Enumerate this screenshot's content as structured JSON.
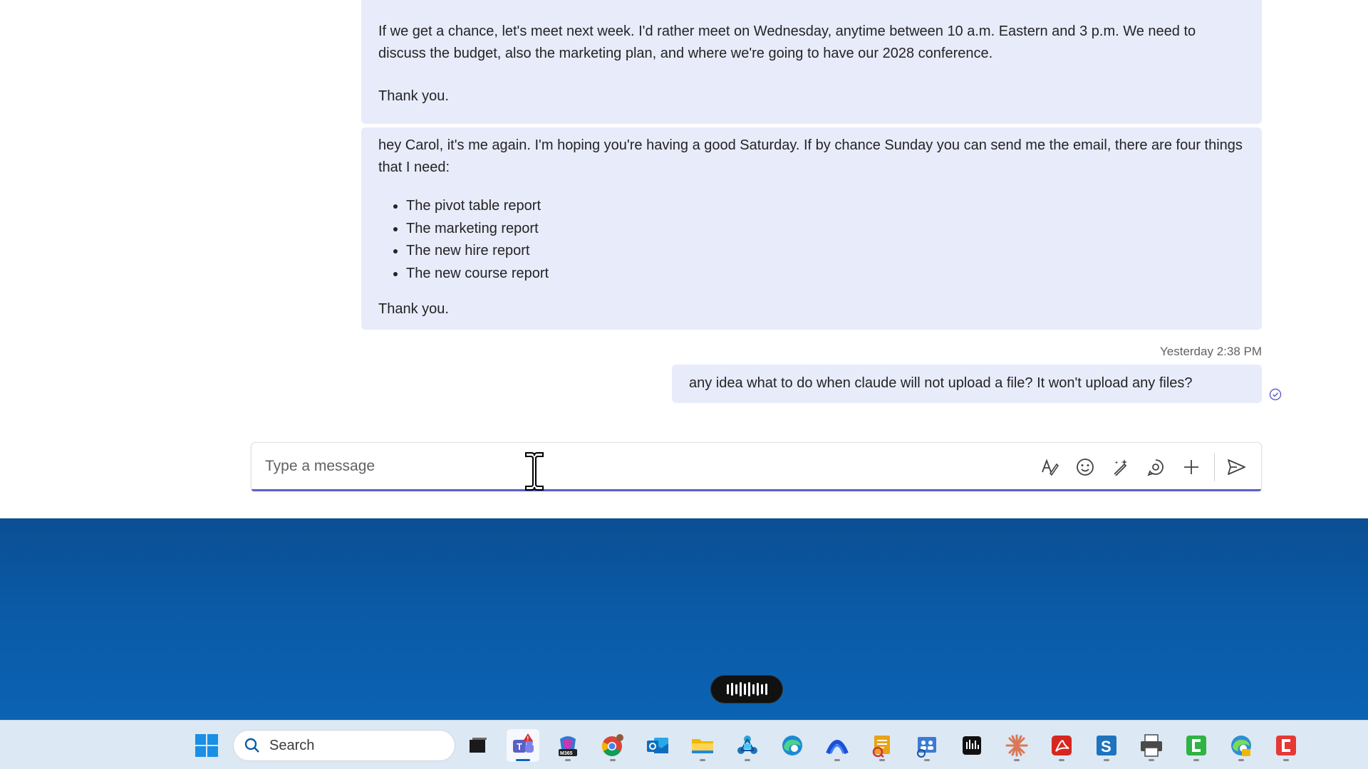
{
  "messages": {
    "msg1": {
      "partial_line": "",
      "paragraph": "If we get a chance, let's meet next week. I'd rather meet on Wednesday, anytime between 10 a.m. Eastern and 3 p.m. We need to discuss the budget, also the marketing plan, and where we're going to have our 2028 conference.",
      "closing": "Thank you."
    },
    "msg2": {
      "paragraph": "hey Carol, it's me again. I'm hoping you're having a good Saturday. If by chance Sunday you can send me the email, there are four things that I need:",
      "items": [
        "The pivot table report",
        "The marketing report",
        "The new hire report",
        "The new course report"
      ],
      "closing": "Thank you."
    },
    "timestamp": "Yesterday 2:38 PM",
    "my_message": "any idea what to do when claude will not upload a file? It won't upload any files?"
  },
  "compose": {
    "placeholder": "Type a message",
    "tools": [
      "format-icon",
      "emoji-icon",
      "copilot-icon",
      "loop-icon",
      "add-icon",
      "send-icon"
    ]
  },
  "taskbar": {
    "search_label": "Search",
    "apps": [
      {
        "name": "task-view",
        "color": "#1a1a1a"
      },
      {
        "name": "teams",
        "color": "#5b5fc7"
      },
      {
        "name": "m365",
        "color": "#2b7cd3"
      },
      {
        "name": "chrome",
        "color": "#db4437"
      },
      {
        "name": "outlook",
        "color": "#0f6cbd"
      },
      {
        "name": "file-explorer",
        "color": "#f2b600"
      },
      {
        "name": "network-app",
        "color": "#2aa3d8"
      },
      {
        "name": "edge",
        "color": "#1a8ad4"
      },
      {
        "name": "app-arc",
        "color": "#1d4fd8"
      },
      {
        "name": "notes-app",
        "color": "#e8a317"
      },
      {
        "name": "people-app",
        "color": "#3a7bd5"
      },
      {
        "name": "audio-app",
        "color": "#111111"
      },
      {
        "name": "claude",
        "color": "#d97757"
      },
      {
        "name": "acrobat",
        "color": "#d7261e"
      },
      {
        "name": "app-s",
        "color": "#1e73be"
      },
      {
        "name": "printer-app",
        "color": "#4a4a4a"
      },
      {
        "name": "app-green",
        "color": "#2fb344"
      },
      {
        "name": "edge-beta",
        "color": "#2b8fd6"
      },
      {
        "name": "app-red",
        "color": "#e53935"
      }
    ]
  },
  "colors": {
    "bubble": "#e8ebfa",
    "accent": "#5b5fc7",
    "desktop": "#0a5aa6",
    "taskbar": "#dce8f3"
  }
}
